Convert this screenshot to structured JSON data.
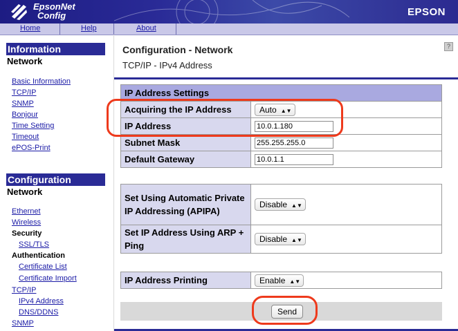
{
  "header": {
    "brand_line1": "EpsonNet",
    "brand_line2": "Config",
    "brand_right": "EPSON"
  },
  "navbar": {
    "home": "Home",
    "help": "Help",
    "about": "About"
  },
  "sidebar": {
    "information": {
      "heading": "Information",
      "sub": "Network",
      "links": [
        "Basic Information",
        "TCP/IP",
        "SNMP",
        "Bonjour",
        "Time Setting",
        "Timeout",
        "ePOS-Print"
      ]
    },
    "configuration": {
      "heading": "Configuration",
      "sub": "Network",
      "ethernet": "Ethernet",
      "wireless": "Wireless",
      "security": "Security",
      "ssl_tls": "SSL/TLS",
      "authentication": "Authentication",
      "certificate_list": "Certificate List",
      "certificate_import": "Certificate Import",
      "tcpip": "TCP/IP",
      "ipv4": "IPv4 Address",
      "dns": "DNS/DDNS",
      "snmp": "SNMP"
    }
  },
  "main": {
    "title": "Configuration - Network",
    "subtitle": "TCP/IP - IPv4 Address",
    "help_icon": "?",
    "ip_settings": {
      "header": "IP Address Settings",
      "acquiring_label": "Acquiring the IP Address",
      "acquiring_value": "Auto",
      "ip_label": "IP Address",
      "ip_value": "10.0.1.180",
      "subnet_label": "Subnet Mask",
      "subnet_value": "255.255.255.0",
      "gateway_label": "Default Gateway",
      "gateway_value": "10.0.1.1"
    },
    "apipa": {
      "label": "Set Using Automatic Private IP Addressing (APIPA)",
      "value": "Disable"
    },
    "arp": {
      "label": "Set IP Address Using ARP + Ping",
      "value": "Disable"
    },
    "printing": {
      "label": "IP Address Printing",
      "value": "Enable"
    },
    "send_label": "Send"
  },
  "colors": {
    "accent": "#2a2b96",
    "highlight": "#ee3a1c",
    "label_bg": "#d8d8ee",
    "header_bg": "#a9a9e0"
  }
}
